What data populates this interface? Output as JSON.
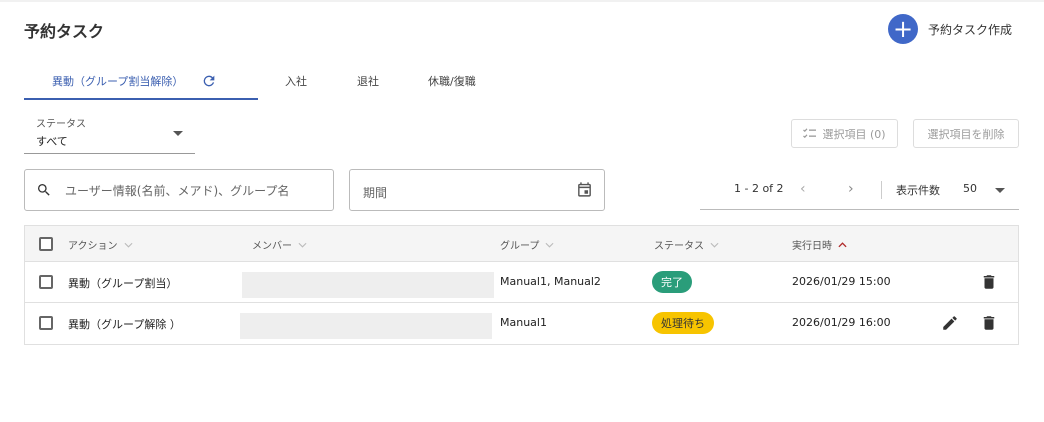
{
  "header": {
    "title": "予約タスク",
    "create_icon": "plus-icon",
    "create_label": "予約タスク作成"
  },
  "tabs": [
    {
      "label": "異動（グループ割当解除）",
      "active": true
    },
    {
      "label": "入社",
      "active": false
    },
    {
      "label": "退社",
      "active": false
    },
    {
      "label": "休職/復職",
      "active": false
    }
  ],
  "filter": {
    "status_label": "ステータス",
    "status_value": "すべて",
    "search_placeholder": "ユーザー情報(名前、メアド)、グループ名",
    "date_placeholder": "期間"
  },
  "actions": {
    "selected_items": "選択項目 (0)",
    "delete_selected": "選択項目を削除"
  },
  "pagination": {
    "range": "1 - 2 of 2",
    "page_size_label": "表示件数",
    "page_size": "50"
  },
  "table": {
    "columns": [
      "アクション",
      "メンバー",
      "グループ",
      "ステータス",
      "実行日時"
    ],
    "rows": [
      {
        "action": "異動（グループ割当）",
        "member": "",
        "group": "Manual1, Manual2",
        "status": "完了",
        "datetime": "2026/01/29 15:00"
      },
      {
        "action": "異動（グループ解除 ）",
        "member": "",
        "group": "Manual1",
        "status": "処理待ち",
        "datetime": "2026/01/29 16:00"
      }
    ]
  },
  "colors": {
    "accent": "#3b5fb0",
    "create_button": "#4068c8",
    "status_done": "#2a9d7a",
    "status_waiting": "#f7c400",
    "sort_active": "#b02a2a"
  }
}
